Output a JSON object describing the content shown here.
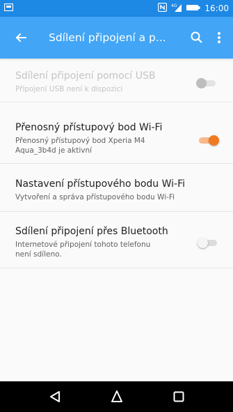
{
  "status_bar": {
    "time": "16:00",
    "icons": [
      "notification-icon",
      "nfc-icon",
      "signal-icon",
      "battery-icon"
    ]
  },
  "toolbar": {
    "title": "Sdílení připojení a p...",
    "icons": [
      "back-arrow-icon",
      "search-icon",
      "more-vert-icon"
    ],
    "color": "#42a5f5"
  },
  "items": [
    {
      "title": "Sdílení připojení pomocí USB",
      "subtitle": "Připojení USB není k dispozici",
      "enabled": false,
      "toggle": "off"
    },
    {
      "title": "Přenosný přístupový bod Wi-Fi",
      "subtitle_line1": "Přenosný přístupový bod Xperia M4",
      "subtitle_line2": "Aqua_3b4d je aktivní",
      "enabled": true,
      "toggle": "on"
    },
    {
      "title": "Nastavení přístupového bodu Wi-Fi",
      "subtitle": "Vytvoření a správa přístupového bodu Wi-Fi",
      "enabled": true
    },
    {
      "title": "Sdílení připojení přes Bluetooth",
      "subtitle_line1": "Internetové připojení tohoto telefonu",
      "subtitle_line2": "není sdíleno.",
      "enabled": true,
      "toggle": "off"
    }
  ],
  "nav_bar": {
    "icons": [
      "back-icon",
      "home-icon",
      "recents-icon"
    ]
  },
  "colors": {
    "status_bar": "#1e88e5",
    "accent": "#f07a22"
  }
}
